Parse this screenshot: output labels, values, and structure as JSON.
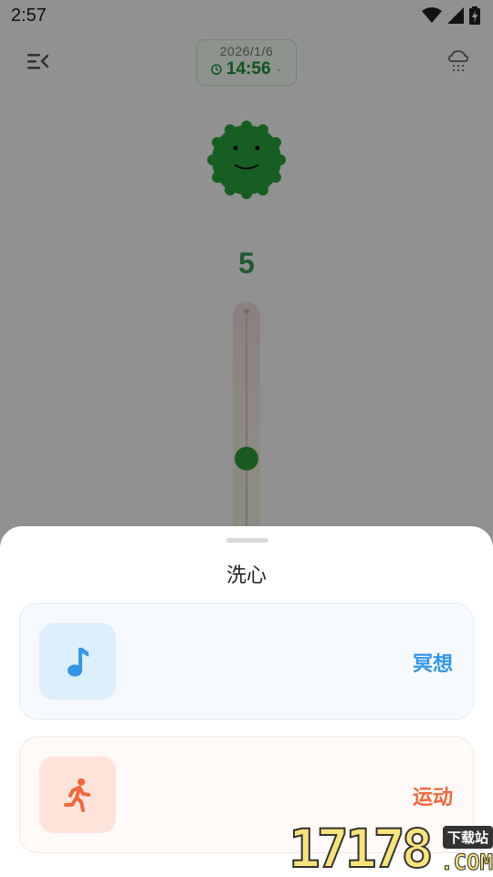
{
  "status_bar": {
    "time": "2:57"
  },
  "header": {
    "date": "2026/1/6",
    "time": "14:56"
  },
  "mood": {
    "score": "5",
    "slider_level": 5,
    "accent_color": "#2c9e3a"
  },
  "sheet": {
    "title": "洗心",
    "options": [
      {
        "label": "冥想",
        "icon": "music-note-icon",
        "color": "#3396e8"
      },
      {
        "label": "运动",
        "icon": "running-person-icon",
        "color": "#f2683b"
      }
    ]
  },
  "watermark": {
    "number": "17178",
    "tag": "下载站",
    "suffix": ".COM"
  }
}
